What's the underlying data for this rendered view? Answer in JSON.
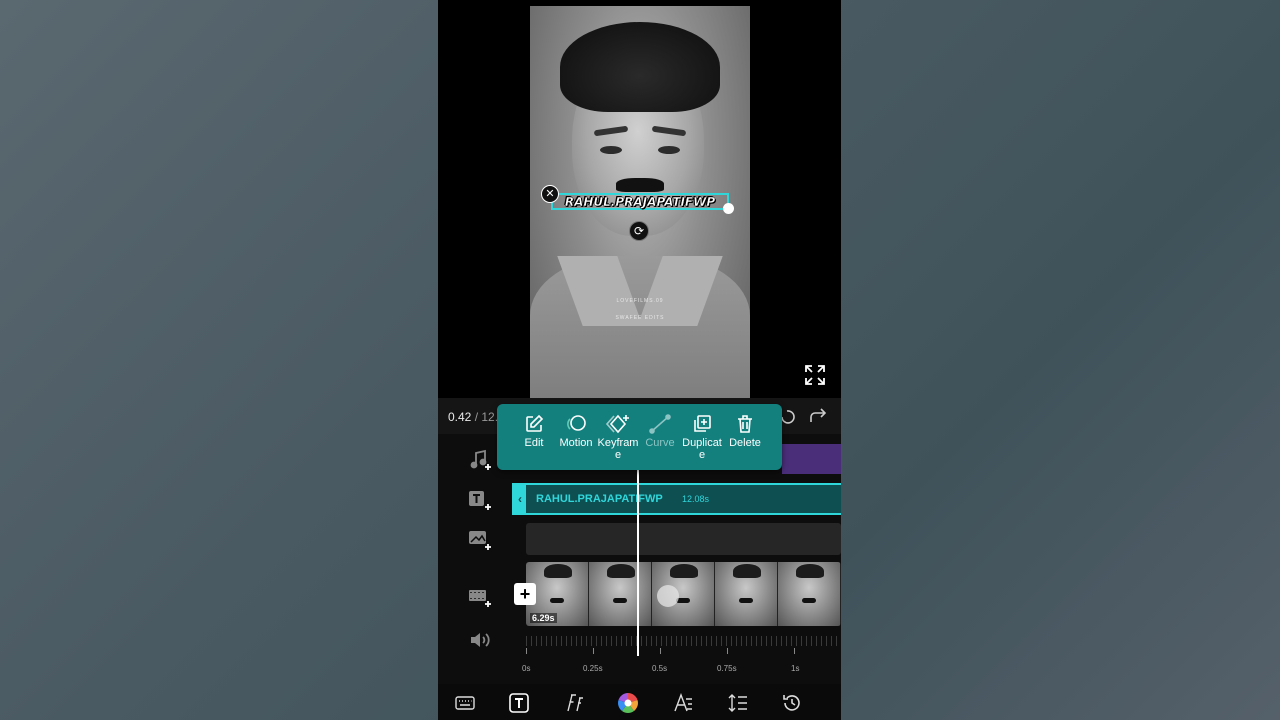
{
  "preview": {
    "overlay_text": "RAHUL.PRAJAPATIFWP",
    "watermark_line1": "LOVEFILMS.09",
    "watermark_line2": "SWAFEE EDITS",
    "close_glyph": "✕",
    "rotate_glyph": "⟳"
  },
  "playback": {
    "current_time": "0.42",
    "total_time": "/ 12."
  },
  "popover": {
    "items": [
      {
        "label": "Edit",
        "icon": "edit-icon"
      },
      {
        "label": "Motion",
        "icon": "motion-icon"
      },
      {
        "label": "Keyframe",
        "icon": "keyframe-icon"
      },
      {
        "label": "Curve",
        "icon": "curve-icon"
      },
      {
        "label": "Duplicate",
        "icon": "duplicate-icon"
      },
      {
        "label": "Delete",
        "icon": "trash-icon"
      }
    ],
    "label_edit": "Edit",
    "label_motion": "Motion",
    "label_keyframe_l1": "Keyfram",
    "label_keyframe_l2": "e",
    "label_curve": "Curve",
    "label_duplicate_l1": "Duplicat",
    "label_duplicate_l2": "e",
    "label_delete": "Delete"
  },
  "timeline": {
    "text_track_label": "RAHUL.PRAJAPATIFWP",
    "text_track_duration": "12.08s",
    "text_track_handle": "‹",
    "clip_duration": "6.29s",
    "add_clip_glyph": "+",
    "ruler": [
      "0s",
      "0.25s",
      "0.5s",
      "0.75s",
      "1s"
    ]
  },
  "colors": {
    "accent": "#2fd6da",
    "popover_bg": "#13807e",
    "music_track": "#4a2e7a"
  }
}
